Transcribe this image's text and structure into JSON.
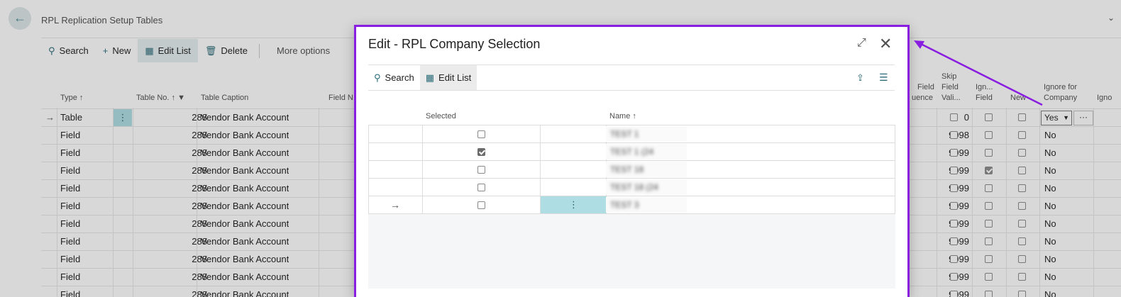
{
  "page": {
    "title": "RPL Replication Setup Tables",
    "toolbar": {
      "search": "Search",
      "new": "New",
      "edit_list": "Edit List",
      "delete": "Delete",
      "more": "More options"
    },
    "columns": {
      "type": "Type ↑",
      "table_no": "Table No. ↑",
      "table_caption": "Table Caption",
      "field_no": "Field N",
      "field_sequence_1": "Field",
      "field_sequence_2": "uence",
      "skip_1": "Skip",
      "skip_2": "Field",
      "skip_3": "Vali...",
      "ign_1": "Ign...",
      "ign_2": "Field",
      "new": "New",
      "ignore_company_1": "Ignore for",
      "ignore_company_2": "Company",
      "ignore_cut": "Igno"
    },
    "rows": [
      {
        "type": "Table",
        "table_no": "288",
        "caption": "Vendor Bank Account",
        "seq": "0",
        "skip": false,
        "ign": false,
        "new": false,
        "ignore_company": "Yes"
      },
      {
        "type": "Field",
        "table_no": "288",
        "caption": "Vendor Bank Account",
        "seq": "9998",
        "skip": false,
        "ign": false,
        "new": false,
        "ignore_company": "No"
      },
      {
        "type": "Field",
        "table_no": "288",
        "caption": "Vendor Bank Account",
        "seq": "9999",
        "skip": false,
        "ign": false,
        "new": false,
        "ignore_company": "No"
      },
      {
        "type": "Field",
        "table_no": "288",
        "caption": "Vendor Bank Account",
        "seq": "9999",
        "skip": false,
        "ign": true,
        "new": false,
        "ignore_company": "No"
      },
      {
        "type": "Field",
        "table_no": "288",
        "caption": "Vendor Bank Account",
        "seq": "9999",
        "skip": false,
        "ign": false,
        "new": false,
        "ignore_company": "No"
      },
      {
        "type": "Field",
        "table_no": "288",
        "caption": "Vendor Bank Account",
        "seq": "9999",
        "skip": false,
        "ign": false,
        "new": false,
        "ignore_company": "No"
      },
      {
        "type": "Field",
        "table_no": "288",
        "caption": "Vendor Bank Account",
        "seq": "9999",
        "skip": false,
        "ign": false,
        "new": false,
        "ignore_company": "No"
      },
      {
        "type": "Field",
        "table_no": "288",
        "caption": "Vendor Bank Account",
        "seq": "9999",
        "skip": false,
        "ign": false,
        "new": false,
        "ignore_company": "No"
      },
      {
        "type": "Field",
        "table_no": "288",
        "caption": "Vendor Bank Account",
        "seq": "9999",
        "skip": false,
        "ign": false,
        "new": false,
        "ignore_company": "No"
      },
      {
        "type": "Field",
        "table_no": "288",
        "caption": "Vendor Bank Account",
        "seq": "9999",
        "skip": false,
        "ign": false,
        "new": false,
        "ignore_company": "No"
      },
      {
        "type": "Field",
        "table_no": "288",
        "caption": "Vendor Bank Account",
        "seq": "9999",
        "skip": false,
        "ign": false,
        "new": false,
        "ignore_company": "No"
      }
    ]
  },
  "dialog": {
    "title": "Edit - RPL Company Selection",
    "toolbar": {
      "search": "Search",
      "edit_list": "Edit List"
    },
    "columns": {
      "selected": "Selected",
      "name": "Name ↑"
    },
    "rows": [
      {
        "selected": false,
        "name": "TEST 1"
      },
      {
        "selected": true,
        "name": "TEST 1 (24"
      },
      {
        "selected": false,
        "name": "TEST 18"
      },
      {
        "selected": false,
        "name": "TEST 18 (24"
      },
      {
        "selected": false,
        "name": "TEST 3"
      }
    ]
  },
  "icons": {
    "back": "arrow-left-icon",
    "search": "search-icon",
    "add": "plus-icon",
    "edit_list": "edit-list-icon",
    "delete": "trash-icon",
    "expand": "expand-icon",
    "close": "close-icon",
    "share": "share-icon",
    "list": "list-view-icon",
    "row_pointer": "arrow-right-icon",
    "row_menu": "vertical-dots-icon"
  },
  "colors": {
    "accent": "#2a6b78",
    "highlight": "#aedde3",
    "annotation": "#8a1ee0"
  }
}
